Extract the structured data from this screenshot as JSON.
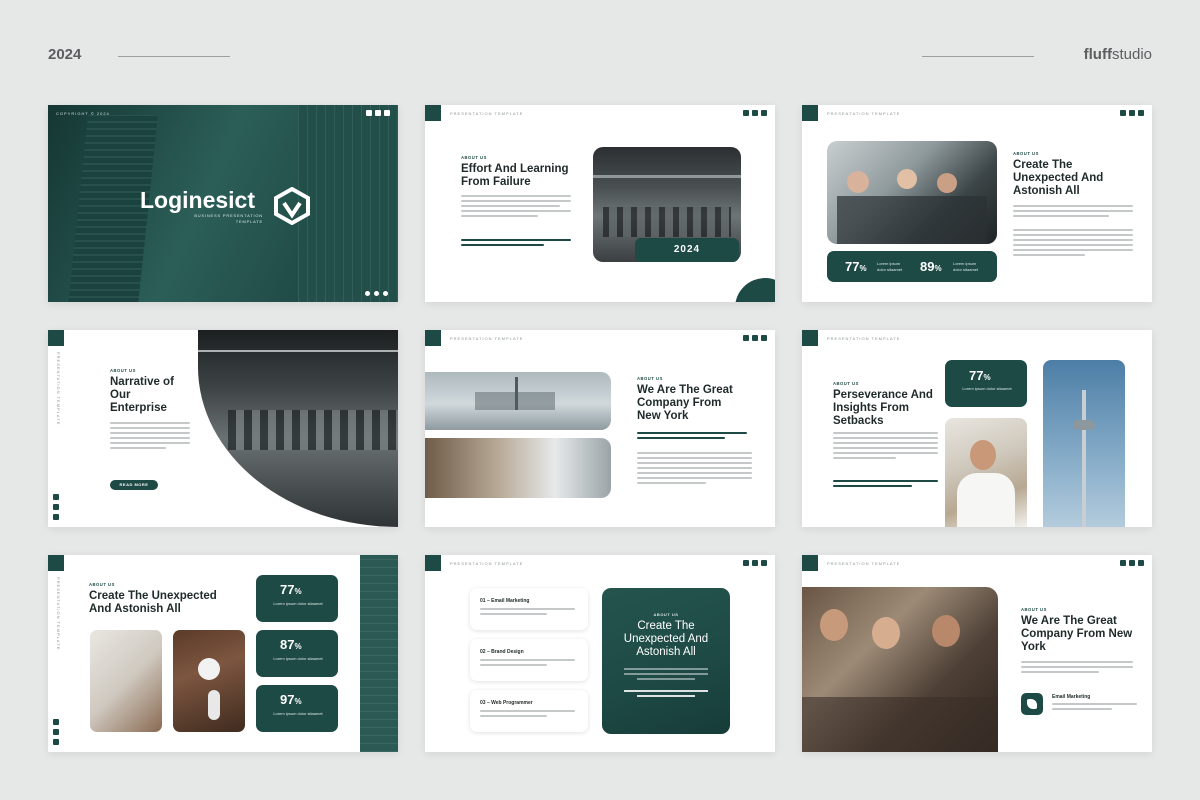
{
  "header": {
    "year": "2024",
    "brand_bold": "fluff",
    "brand_rest": "studio"
  },
  "common": {
    "copyright": "COPYRIGHT © 2024",
    "tag": "PRESENTATION TEMPLATE",
    "about": "ABOUT US"
  },
  "cover": {
    "title": "Loginesict",
    "subtitle": "BUSINESS PRESENTATION TEMPLATE"
  },
  "s2": {
    "title": "Effort And Learning From Failure",
    "badge": "2024"
  },
  "s3": {
    "title": "Create The Unexpected And Astonish All",
    "stat1": "77",
    "stat2": "89",
    "unit": "%",
    "stat_label": "Lorem ipsum dolor sitaamet"
  },
  "s4": {
    "title": "Narrative of Our Enterprise",
    "button": "READ MORE"
  },
  "s5": {
    "title": "We Are The Great Company From New York"
  },
  "s6": {
    "title": "Perseverance And Insights From Setbacks",
    "stat": "77",
    "unit": "%",
    "stat_label": "Lorem ipsum dolor sitaamet"
  },
  "s7": {
    "title": "Create The Unexpected And Astonish All",
    "stats": [
      "77",
      "87",
      "97"
    ],
    "unit": "%",
    "stat_label": "Lorem ipsum dolor sitaamet"
  },
  "s8": {
    "items": [
      "01 – Email Marketing",
      "02 – Brand Design",
      "03 – Web Programmer"
    ],
    "card_kicker": "ABOUT US",
    "card_title": "Create The Unexpected And Astonish All"
  },
  "s9": {
    "title": "We Are The Great Company From New York",
    "service": "Email Marketing"
  },
  "colors": {
    "primary": "#1e4a45",
    "background": "#e6e7e7"
  }
}
